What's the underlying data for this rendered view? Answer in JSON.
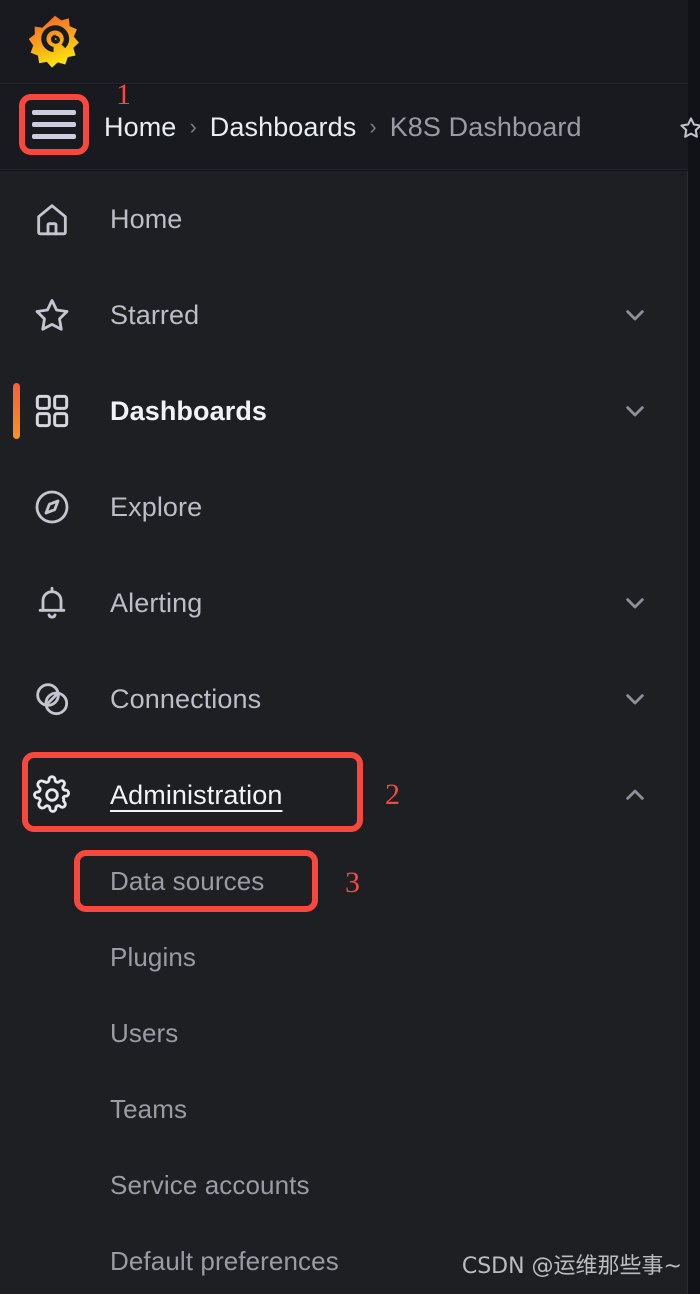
{
  "app": {
    "name": "Grafana",
    "logo_icon": "grafana-logo-icon",
    "accent_color": "#f7941e",
    "accent_color_alt": "#f55f3e",
    "nav_background": "#1e1f23",
    "header_background": "#181a1f",
    "annotation_color": "#f8483e"
  },
  "header": {
    "menu_button_icon": "hamburger-menu-icon",
    "breadcrumb": [
      {
        "label": "Home",
        "state": "strong"
      },
      {
        "label": "Dashboards",
        "state": "strong"
      },
      {
        "label": "K8S Dashboard",
        "state": "dim"
      }
    ],
    "separator": "›",
    "star_icon": "star-icon"
  },
  "nav": {
    "items": [
      {
        "label": "Home",
        "icon": "home-icon",
        "expandable": false,
        "active": false,
        "hovered": false
      },
      {
        "label": "Starred",
        "icon": "star-icon",
        "expandable": true,
        "expanded": false,
        "active": false,
        "hovered": false
      },
      {
        "label": "Dashboards",
        "icon": "dashboards-grid-icon",
        "expandable": true,
        "expanded": false,
        "active": true,
        "hovered": false
      },
      {
        "label": "Explore",
        "icon": "compass-icon",
        "expandable": false,
        "active": false,
        "hovered": false
      },
      {
        "label": "Alerting",
        "icon": "bell-icon",
        "expandable": true,
        "expanded": false,
        "active": false,
        "hovered": false
      },
      {
        "label": "Connections",
        "icon": "connections-icon",
        "expandable": true,
        "expanded": false,
        "active": false,
        "hovered": false
      },
      {
        "label": "Administration",
        "icon": "gear-icon",
        "expandable": true,
        "expanded": true,
        "active": false,
        "hovered": true
      }
    ],
    "administration_children": [
      {
        "label": "Data sources"
      },
      {
        "label": "Plugins"
      },
      {
        "label": "Users"
      },
      {
        "label": "Teams"
      },
      {
        "label": "Service accounts"
      },
      {
        "label": "Default preferences"
      }
    ]
  },
  "annotations": [
    {
      "number": "1",
      "target": "hamburger-menu-button"
    },
    {
      "number": "2",
      "target": "nav-item-administration"
    },
    {
      "number": "3",
      "target": "nav-subitem-data-sources"
    }
  ],
  "watermark": {
    "text": "CSDN @运维那些事~"
  }
}
